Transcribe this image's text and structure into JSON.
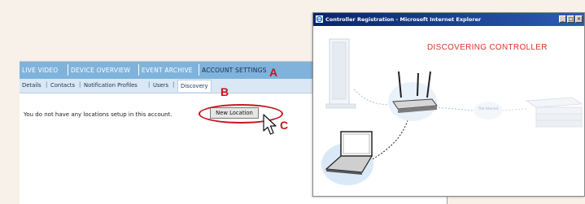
{
  "left_window": {
    "top_tabs": [
      {
        "label": "LIVE VIDEO",
        "active": false
      },
      {
        "label": "DEVICE OVERVIEW",
        "active": false
      },
      {
        "label": "EVENT ARCHIVE",
        "active": false
      },
      {
        "label": "ACCOUNT SETTINGS",
        "active": true
      }
    ],
    "sub_tabs": [
      {
        "label": "Details",
        "active": false
      },
      {
        "label": "Contacts",
        "active": false
      },
      {
        "label": "Notification Profiles",
        "active": false
      },
      {
        "label": "Users",
        "active": false
      },
      {
        "label": "Discovery",
        "active": true
      }
    ],
    "message": "You do not have any locations setup in this account.",
    "new_location_label": "New Location"
  },
  "callouts": {
    "a": "A",
    "b": "B",
    "c": "C"
  },
  "right_window": {
    "title": "Controller Registration - Microsoft Internet Explorer",
    "controls": {
      "minimize": "_",
      "maximize": "□",
      "close": "×"
    },
    "heading": "DISCOVERING CONTROLLER",
    "internet_label": "The Internet"
  },
  "colors": {
    "accent_red": "#c4161c",
    "nav_blue": "#7fb3dc",
    "subnav_blue": "#d9e8f4",
    "heading_red": "#d8352a",
    "titlebar_blue": "#0a2468"
  },
  "icons": [
    "mouse-pointer-icon",
    "ie-logo-icon",
    "server-icon",
    "router-icon",
    "laptop-icon",
    "internet-cloud-icon",
    "network-rack-icon"
  ]
}
